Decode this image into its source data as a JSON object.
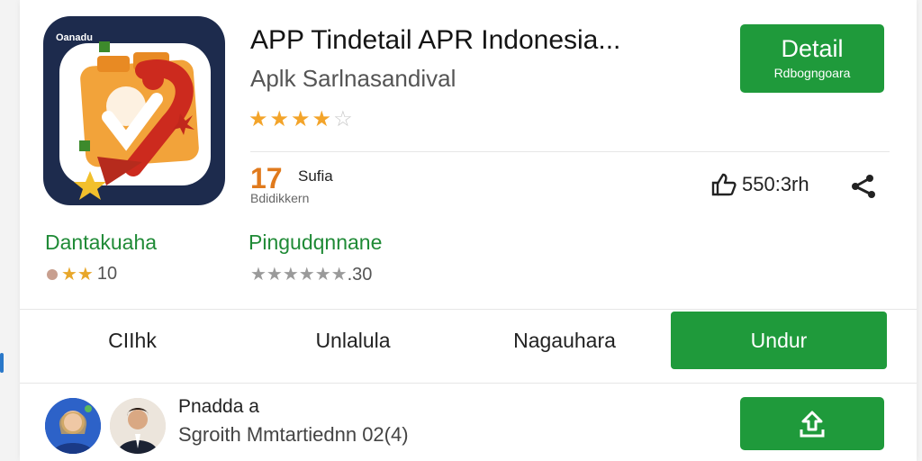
{
  "app": {
    "badge_text": "Oanadu",
    "title": "APP Tindetail APR Indonesia...",
    "subtitle": "Aplk Sarlnasandival",
    "stars_on": "★★★★",
    "stars_off": "☆"
  },
  "detail_button": {
    "label": "Detail",
    "sublabel": "Rdbogngoara"
  },
  "stats": {
    "number": "17",
    "label": "Sufia",
    "sublabel": "Bdidikkern",
    "likes": "550:3rh"
  },
  "developer": {
    "name": "Dantakuaha",
    "rating_stars": "★★",
    "rating_value": "10",
    "category": "Pingudqnnane",
    "category_stars": "★★★★★★",
    "category_rating": ".30"
  },
  "tabs": [
    {
      "label": "CIIhk"
    },
    {
      "label": "Unlalula"
    },
    {
      "label": "Nagauhara"
    },
    {
      "label": "Undur"
    }
  ],
  "review": {
    "name": "Pnadda a",
    "subtitle": "Sgroith Mmtartiednn 02(4)"
  },
  "colors": {
    "brand_green": "#1f9a3b",
    "star_orange": "#f3a42a",
    "navy_icon": "#1d2b4d"
  },
  "icons": [
    "thumbs-up-icon",
    "share-icon",
    "upload-icon",
    "star-icon"
  ]
}
